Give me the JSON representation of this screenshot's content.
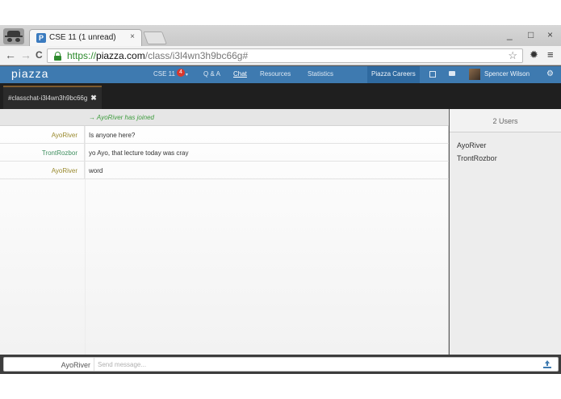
{
  "browser": {
    "tab_title": "CSE 11 (1 unread)",
    "tab_close": "×",
    "favicon_letter": "P",
    "url_scheme": "https://",
    "url_host": "piazza.com",
    "url_path": "/class/i3l4wn3h9bc66g#",
    "window_controls": [
      "_",
      "□",
      "×"
    ],
    "nav": {
      "back": "←",
      "forward": "→",
      "reload": "C"
    },
    "icons": {
      "bookmark": "star-icon",
      "extension": "gear-icon",
      "menu": "hamburger-menu-icon"
    }
  },
  "piazza_nav": {
    "logo": "piazza",
    "class_label": "CSE 11",
    "class_badge": "4",
    "caret": "▾",
    "items": [
      "Q & A",
      "Chat",
      "Resources",
      "Statistics"
    ],
    "active_item": "Chat",
    "careers": "Piazza Careers",
    "user_name": "Spencer Wilson",
    "settings_glyph": "⚙",
    "brand_color": "#3e7ab0"
  },
  "chat": {
    "channel_tab": "#classchat-i3l4wn3h9bc66g",
    "channel_close": "✖",
    "join_notice": "→ AyoRiver has joined",
    "messages": [
      {
        "author": "AyoRiver",
        "text": "Is anyone here?"
      },
      {
        "author": "TrontRozbor",
        "text": "yo Ayo, that lecture today was cray"
      },
      {
        "author": "AyoRiver",
        "text": "word"
      }
    ]
  },
  "users_panel": {
    "count_label": "2 Users",
    "users": [
      "AyoRiver",
      "TrontRozbor"
    ]
  },
  "composer": {
    "username": "AyoRiver",
    "placeholder": "Send message...",
    "value": ""
  }
}
